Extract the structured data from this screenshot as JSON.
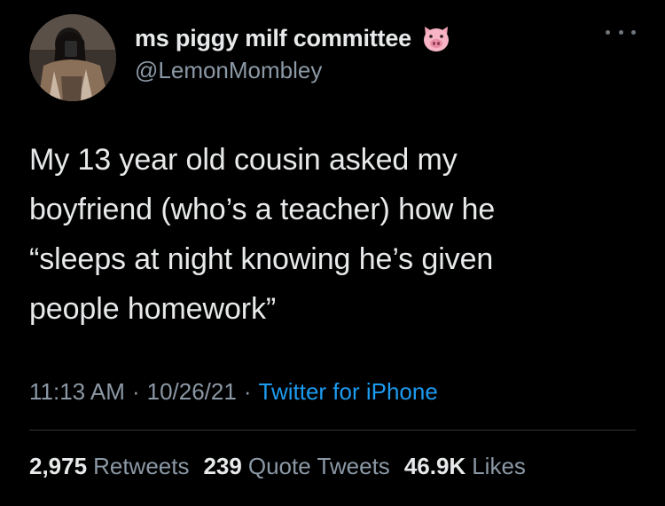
{
  "author": {
    "display_name": "ms piggy milf committee",
    "name_emoji": "pig-face-icon",
    "handle": "@LemonMombley",
    "avatar": "avatar"
  },
  "tweet": {
    "text": "My 13 year old cousin asked my\nboyfriend (who’s a teacher) how he\n“sleeps at night knowing he’s given\npeople homework”",
    "time": "11:13 AM",
    "date": "10/26/21",
    "source": "Twitter for iPhone",
    "separator": "·"
  },
  "stats": {
    "retweets_count": "2,975",
    "retweets_label": "Retweets",
    "quotes_count": "239",
    "quotes_label": "Quote Tweets",
    "likes_count": "46.9K",
    "likes_label": "Likes"
  },
  "menu_icon": "more-options-icon",
  "colors": {
    "background": "#000000",
    "text": "#e7e9ea",
    "secondary": "#8b98a5",
    "link": "#1d9bf0",
    "divider": "#2f3336"
  }
}
